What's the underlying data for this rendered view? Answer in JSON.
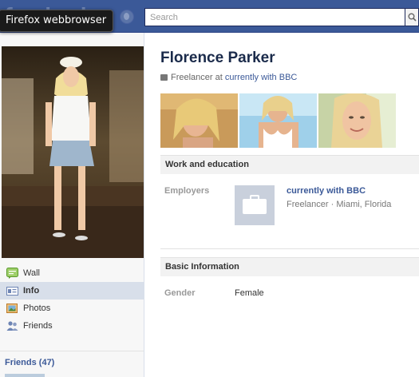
{
  "browser_tooltip": "Firefox webbrowser",
  "header": {
    "logo_text": "facebook",
    "search_placeholder": "Search",
    "brand_color": "#3b5998"
  },
  "sidebar": {
    "nav": [
      {
        "label": "Wall",
        "icon": "wall-icon"
      },
      {
        "label": "Info",
        "icon": "info-icon",
        "active": true
      },
      {
        "label": "Photos",
        "icon": "photos-icon"
      },
      {
        "label": "Friends",
        "icon": "friends-icon"
      }
    ],
    "friends_link": "Friends (47)"
  },
  "profile": {
    "name": "Florence Parker",
    "tagline_prefix": "Freelancer at",
    "tagline_link": "currently with BBC"
  },
  "work": {
    "section_title": "Work and education",
    "label": "Employers",
    "employer_name": "currently with BBC",
    "employer_detail": "Freelancer · Miami, Florida"
  },
  "basic": {
    "section_title": "Basic Information",
    "gender_label": "Gender",
    "gender_value": "Female"
  }
}
